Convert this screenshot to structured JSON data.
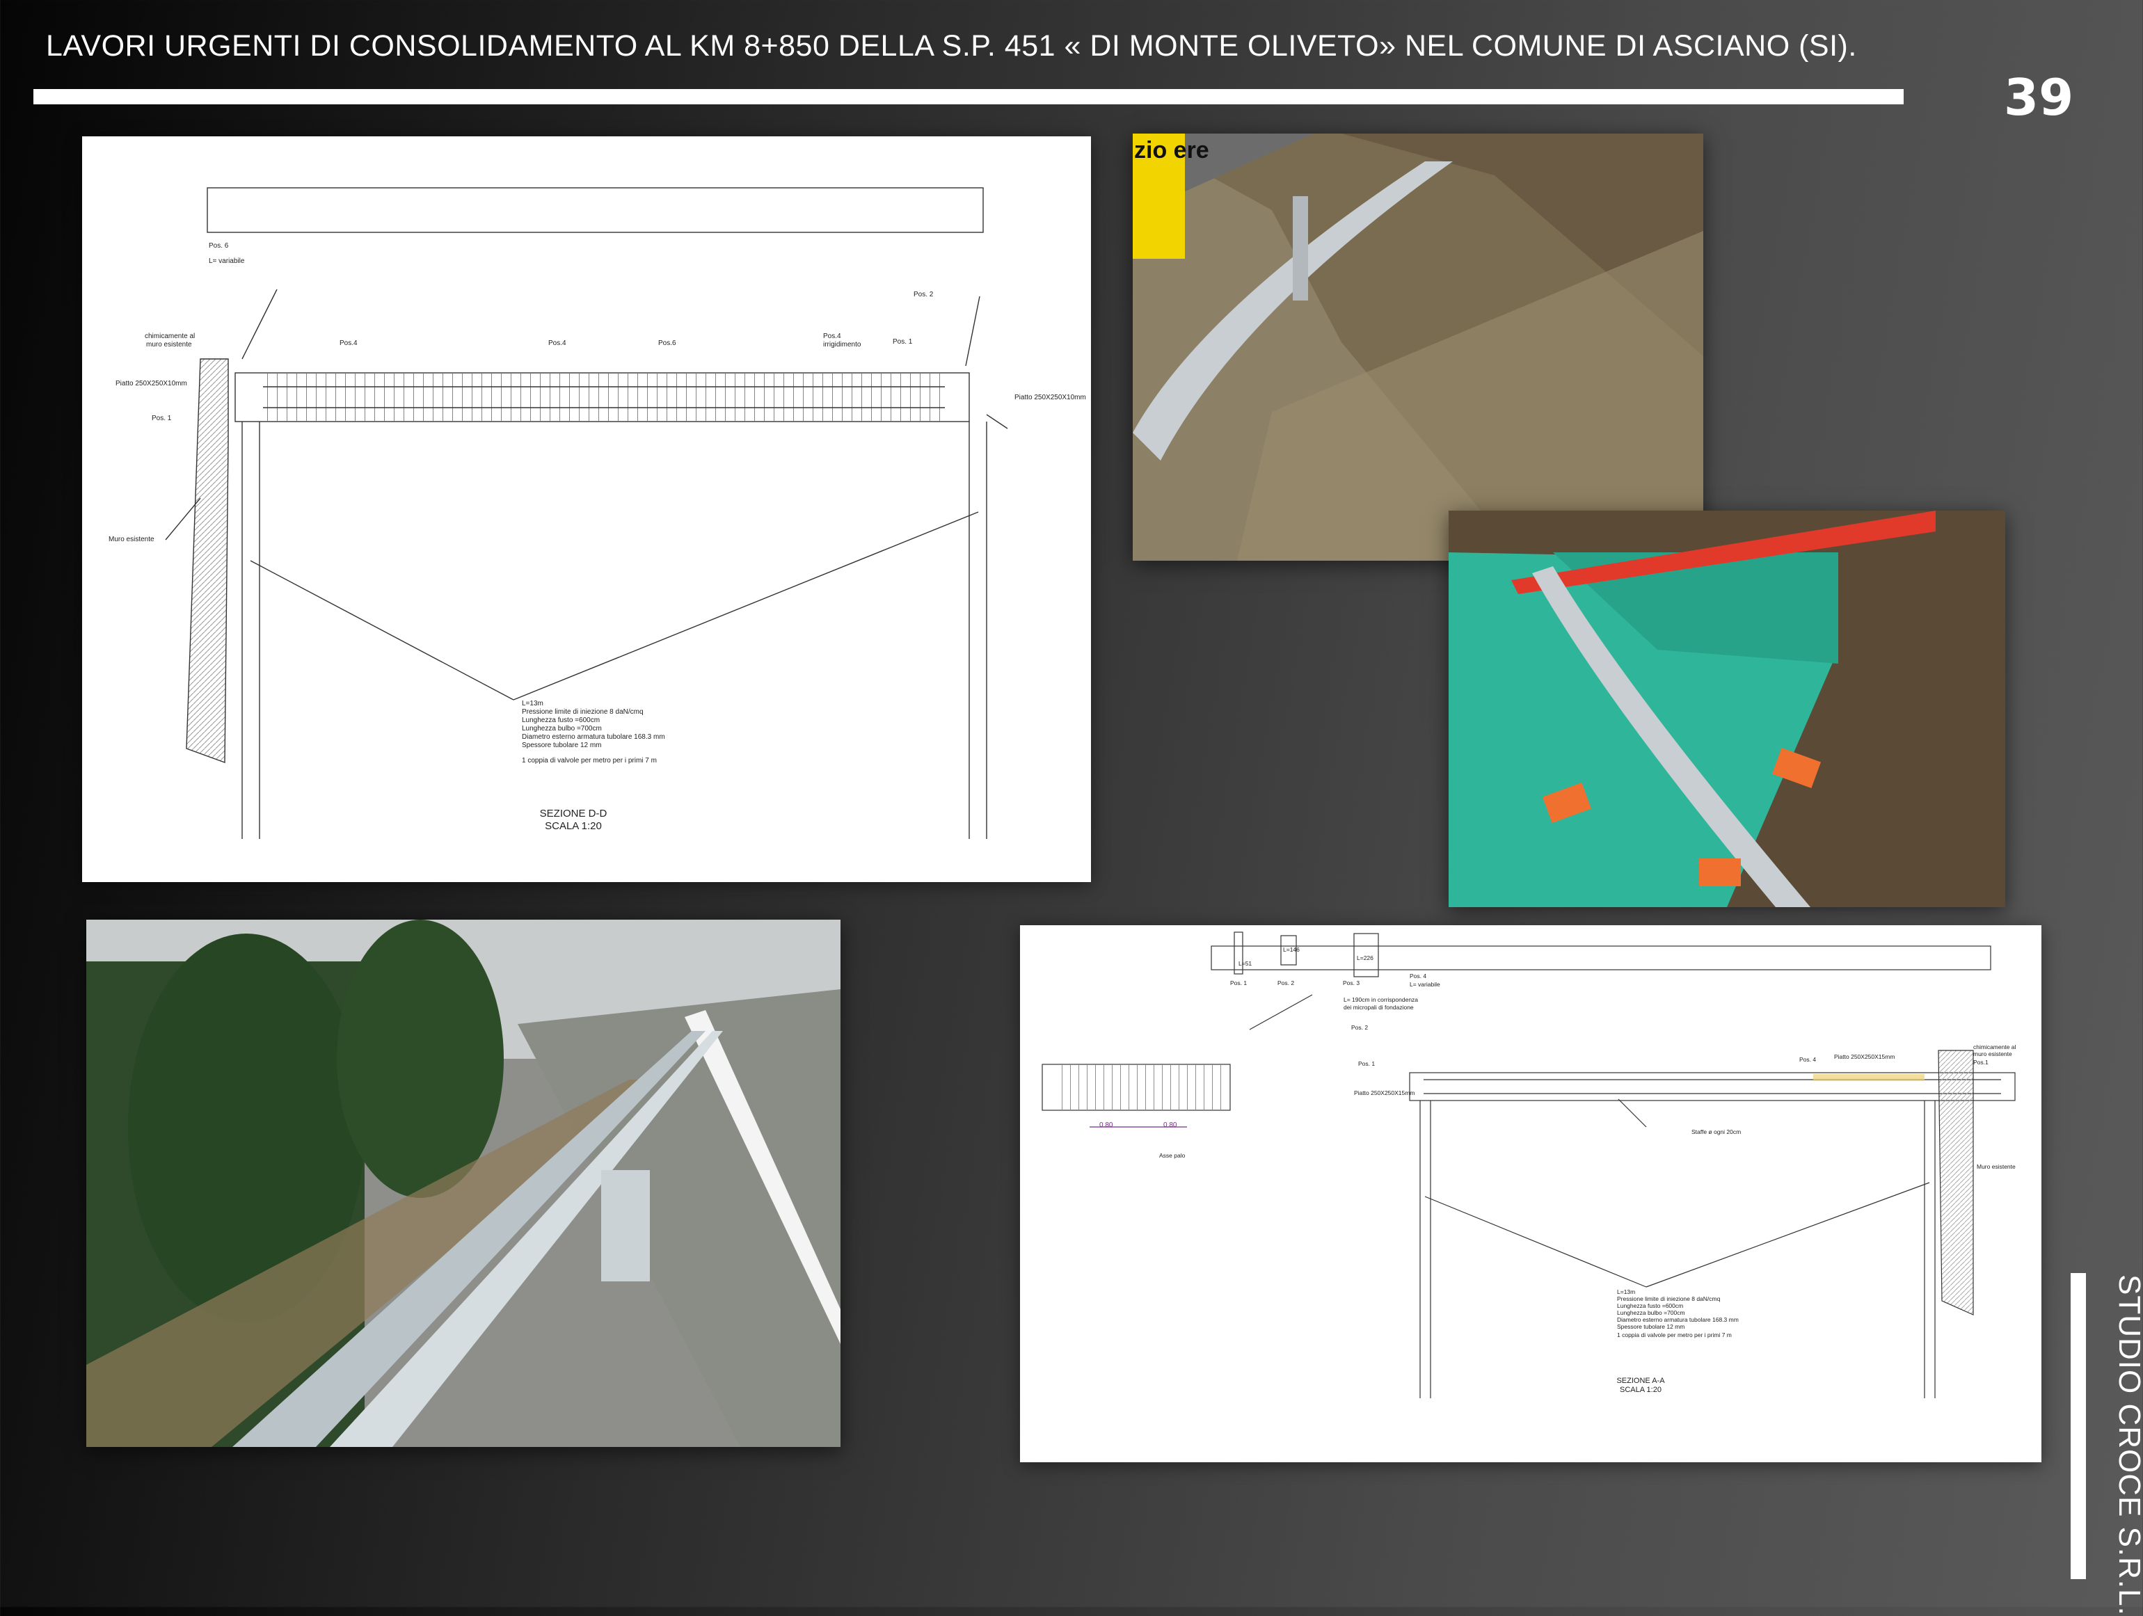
{
  "header": {
    "title": "LAVORI URGENTI DI CONSOLIDAMENTO AL KM 8+850 DELLA S.P. 451 « DI MONTE OLIVETO» NEL COMUNE DI ASCIANO (SI).",
    "page_number": "39"
  },
  "footer": {
    "company": "STUDIO CROCE S.R.L."
  },
  "drawing_dd": {
    "labels": {
      "pos6": "Pos. 6",
      "lvar": "L= variabile",
      "chem1": "chimicamente al",
      "chem2": "muro esistente",
      "pos4a": "Pos.4",
      "pos4b": "Pos.4",
      "pos6b": "Pos.6",
      "pos2": "Pos. 2",
      "pos4c": "Pos.4",
      "irr": "irrigidimento",
      "pos1r": "Pos. 1",
      "plateL": "Piatto 250X250X10mm",
      "plateR": "Piatto 250X250X10mm",
      "pos1l": "Pos. 1",
      "wall": "Muro esistente"
    },
    "spec": [
      "L=13m",
      "Pressione limite di iniezione 8 daN/cmq",
      "Lunghezza fusto =600cm",
      "Lunghezza bulbo =700cm",
      "Diametro esterno armatura tubolare 168.3 mm",
      "Spessore tubolare 12 mm",
      "1 coppia di valvole per metro per i primi 7 m"
    ],
    "section": "SEZIONE D-D",
    "scale": "SCALA 1:20"
  },
  "drawing_aa": {
    "labels": {
      "pos1": "Pos. 1",
      "pos2": "Pos. 2",
      "pos3": "Pos. 3",
      "l51": "L=51",
      "l146": "L=146",
      "l226": "L=226",
      "pos4": "Pos. 4",
      "lvar": "L= variabile",
      "anchor1": "L= 190cm in corrispondenza",
      "anchor2": "dei micropali di fondazione",
      "pos2b": "Pos. 2",
      "pos1b": "Pos. 1",
      "plateL": "Piatto 250X250X15mm",
      "pos4b": "Pos. 4",
      "plateR": "Piatto 250X250X15mm",
      "pos1c": "Pos.1",
      "chem1": "chimicamente al",
      "chem2": "muro esistente",
      "staffe": "Staffe ø ogni 20cm",
      "dim1": "0.80",
      "dim2": "0.80",
      "asse": "Asse palo",
      "wall": "Muro esistente"
    },
    "spec": [
      "L=13m",
      "Pressione limite di iniezione 8 daN/cmq",
      "Lunghezza fusto =600cm",
      "Lunghezza bulbo =700cm",
      "Diametro esterno armatura tubolare 168.3 mm",
      "Spessore tubolare 12 mm",
      "1 coppia di valvole per metro per i primi 7 m"
    ],
    "section": "SEZIONE A-A",
    "scale": "SCALA 1:20"
  },
  "photos": {
    "sign": "zio ere"
  },
  "colors": {
    "background": "#3a3a3a",
    "foreground": "#ffffff",
    "tarp": "#2fb59a",
    "barrier": "#c8ced2",
    "dimension": "#7a2a8a"
  }
}
